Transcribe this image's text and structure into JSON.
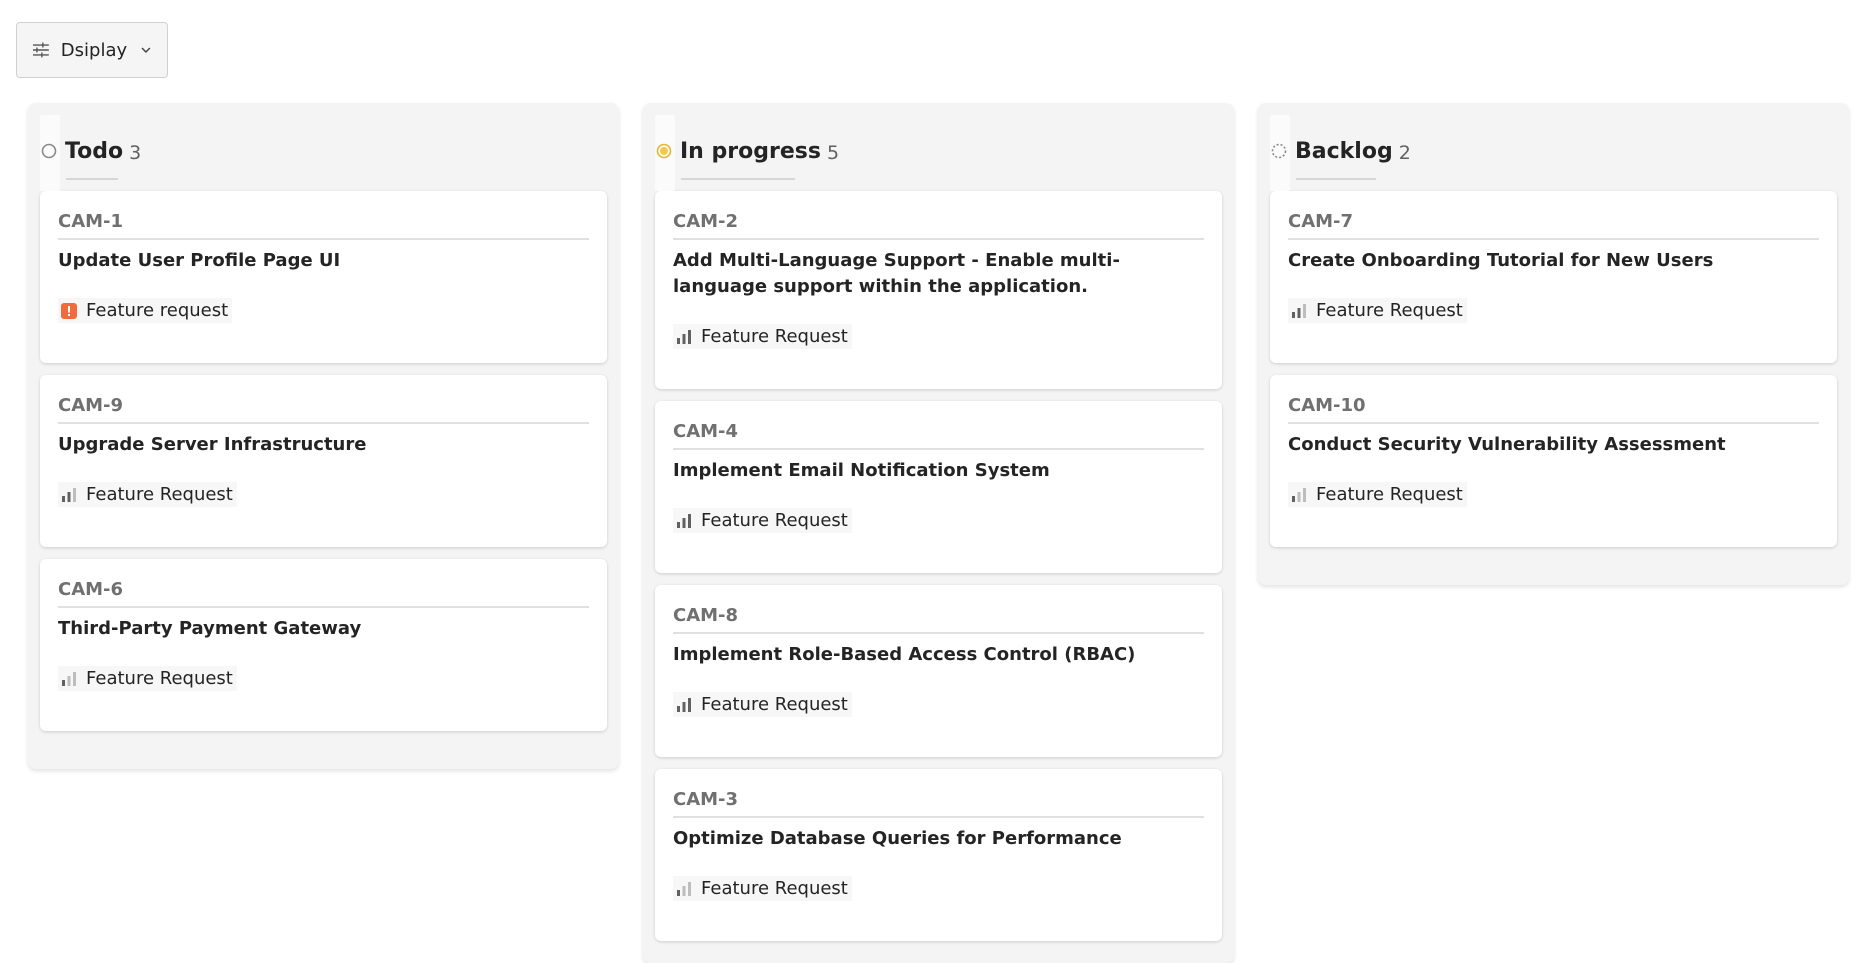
{
  "toolbar": {
    "display_label": "Dsiplay",
    "display_icon": "options-icon",
    "chevron_icon": "chevron-down-icon"
  },
  "columns": [
    {
      "title": "Todo",
      "count": "3",
      "status_icon": "empty-circle-icon",
      "cards": [
        {
          "id": "CAM-1",
          "title": "Update User Profile Page UI",
          "tag": "Feature request",
          "tag_icon": "urgent-priority-icon"
        },
        {
          "id": "CAM-9",
          "title": "Upgrade Server Infrastructure",
          "tag": "Feature Request",
          "tag_icon": "medium-priority-icon"
        },
        {
          "id": "CAM-6",
          "title": "Third-Party Payment Gateway",
          "tag": "Feature Request",
          "tag_icon": "low-priority-icon"
        }
      ]
    },
    {
      "title": "In progress",
      "count": "5",
      "status_icon": "half-filled-circle-icon",
      "cards": [
        {
          "id": "CAM-2",
          "title": "Add Multi-Language Support - Enable multi-language support within the application.",
          "tag": "Feature Request",
          "tag_icon": "high-priority-icon"
        },
        {
          "id": "CAM-4",
          "title": "Implement Email Notification System",
          "tag": "Feature Request",
          "tag_icon": "high-priority-icon"
        },
        {
          "id": "CAM-8",
          "title": "Implement Role-Based Access Control (RBAC)",
          "tag": "Feature Request",
          "tag_icon": "high-priority-icon"
        },
        {
          "id": "CAM-3",
          "title": "Optimize Database Queries for Performance",
          "tag": "Feature Request",
          "tag_icon": "low-priority-icon"
        }
      ]
    },
    {
      "title": "Backlog",
      "count": "2",
      "status_icon": "dashed-circle-icon",
      "cards": [
        {
          "id": "CAM-7",
          "title": "Create Onboarding Tutorial for New Users",
          "tag": "Feature Request",
          "tag_icon": "medium-priority-icon"
        },
        {
          "id": "CAM-10",
          "title": "Conduct Security Vulnerability Assessment",
          "tag": "Feature Request",
          "tag_icon": "low-priority-icon"
        }
      ]
    }
  ],
  "colors": {
    "urgent": "#f26b3a",
    "in_progress": "#f2c94c",
    "priority_bar_active": "#616161",
    "priority_bar_inactive": "#bdbdbd"
  }
}
